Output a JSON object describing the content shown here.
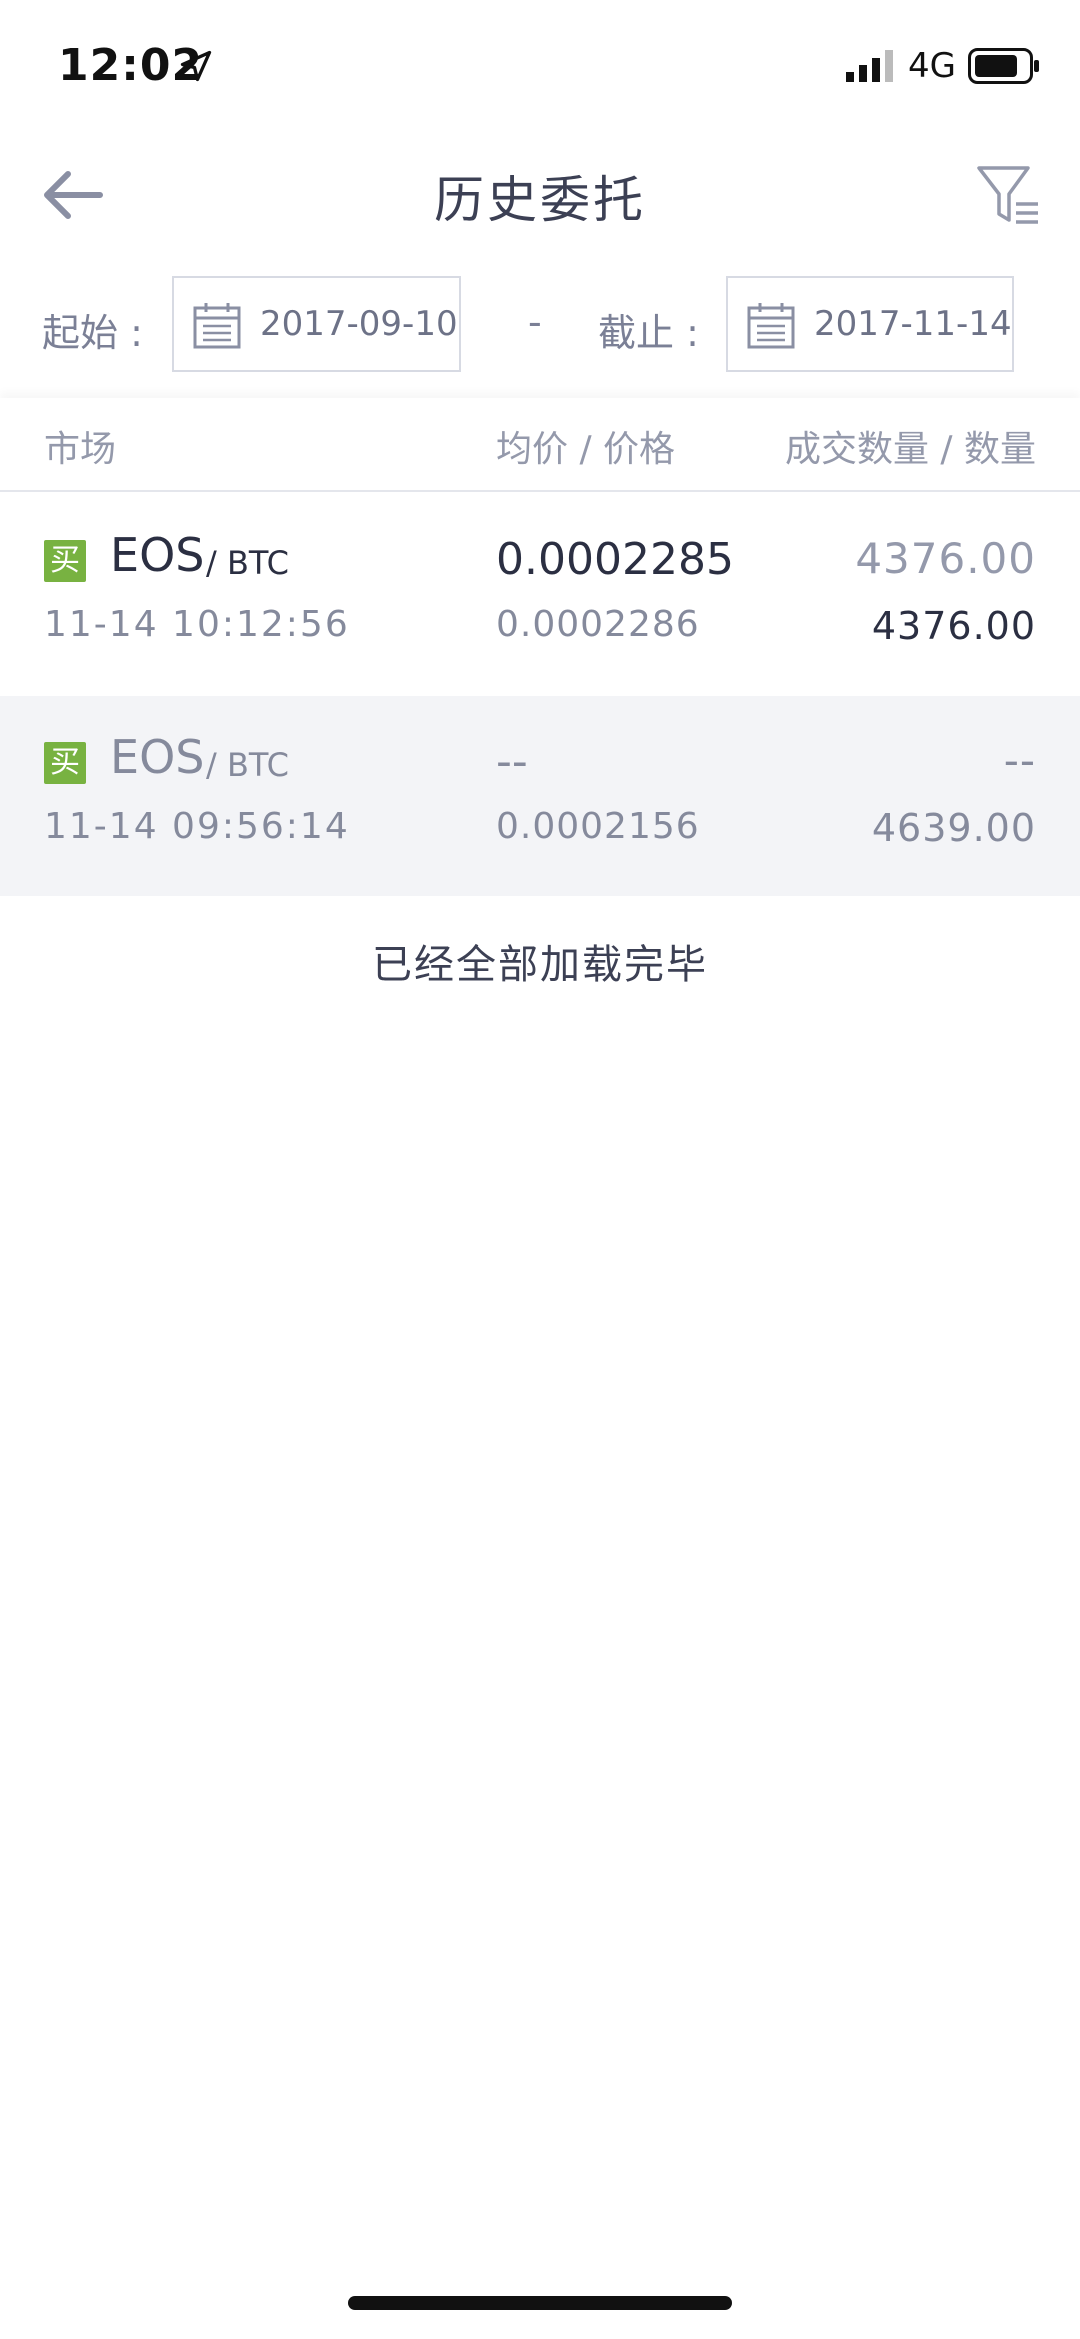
{
  "status_bar": {
    "time": "12:02",
    "network": "4G"
  },
  "nav": {
    "title": "历史委托",
    "back_icon": "arrow-left-icon",
    "filter_icon": "filter-icon"
  },
  "date_filter": {
    "start_label": "起始 :",
    "start_date": "2017-09-10",
    "separator": "-",
    "end_label": "截止 :",
    "end_date": "2017-11-14"
  },
  "table": {
    "headers": {
      "market": "市场",
      "price": "均价 / 价格",
      "quantity": "成交数量 / 数量"
    },
    "rows": [
      {
        "side": "买",
        "base": "EOS",
        "quote": "/ BTC",
        "time": "11-14 10:12:56",
        "avg_price": "0.0002285",
        "price": "0.0002286",
        "filled": "4376.00",
        "quantity": "4376.00"
      },
      {
        "side": "买",
        "base": "EOS",
        "quote": "/ BTC",
        "time": "11-14 09:56:14",
        "avg_price": "--",
        "price": "0.0002156",
        "filled": "--",
        "quantity": "4639.00"
      }
    ]
  },
  "footer": {
    "end_text": "已经全部加载完毕"
  },
  "colors": {
    "buy_badge": "#78b241",
    "text_primary": "#2b2f42",
    "text_secondary": "#858a9c",
    "row_alt": "#f3f4f7"
  }
}
